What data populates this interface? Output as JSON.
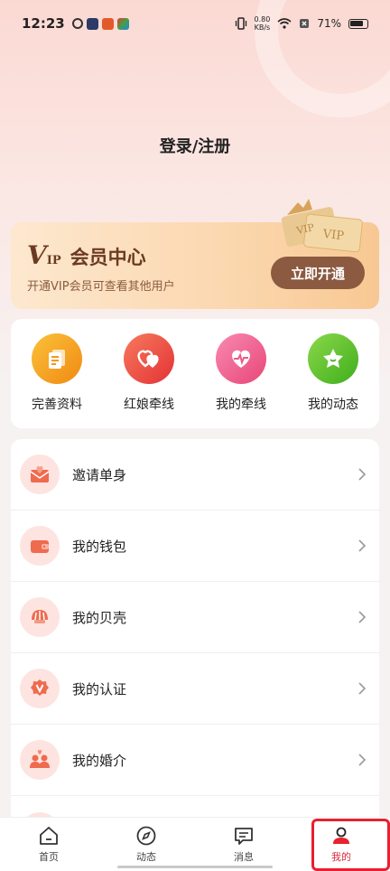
{
  "status_bar": {
    "time": "12:23",
    "net_speed_value": "0.80",
    "net_speed_unit": "KB/s",
    "battery": "71%"
  },
  "header": {
    "login_label": "登录/注册"
  },
  "vip": {
    "brand_v": "V",
    "brand_ip": "IP",
    "title": "会员中心",
    "description": "开通VIP会员可查看其他用户",
    "button_label": "立即开通",
    "badge_text": "VIP"
  },
  "quick_actions": [
    {
      "label": "完善资料",
      "icon": "document-icon",
      "color": "#f6a020"
    },
    {
      "label": "红娘牵线",
      "icon": "hearts-icon",
      "color": "#ee4c44"
    },
    {
      "label": "我的牵线",
      "icon": "heartbeat-icon",
      "color": "#ef5a82"
    },
    {
      "label": "我的动态",
      "icon": "star-icon",
      "color": "#57be2d"
    }
  ],
  "menu": [
    {
      "label": "邀请单身",
      "icon": "envelope-heart-icon"
    },
    {
      "label": "我的钱包",
      "icon": "wallet-icon"
    },
    {
      "label": "我的贝壳",
      "icon": "shell-icon"
    },
    {
      "label": "我的认证",
      "icon": "verified-badge-icon"
    },
    {
      "label": "我的婚介",
      "icon": "couple-icon"
    }
  ],
  "tabs": [
    {
      "label": "首页",
      "icon": "home-icon"
    },
    {
      "label": "动态",
      "icon": "compass-icon"
    },
    {
      "label": "消息",
      "icon": "message-icon"
    },
    {
      "label": "我的",
      "icon": "profile-icon",
      "active": true
    }
  ],
  "colors": {
    "accent": "#e8202f",
    "vip_button": "#8b5a40",
    "menu_icon_bg": "#fde4e0"
  }
}
